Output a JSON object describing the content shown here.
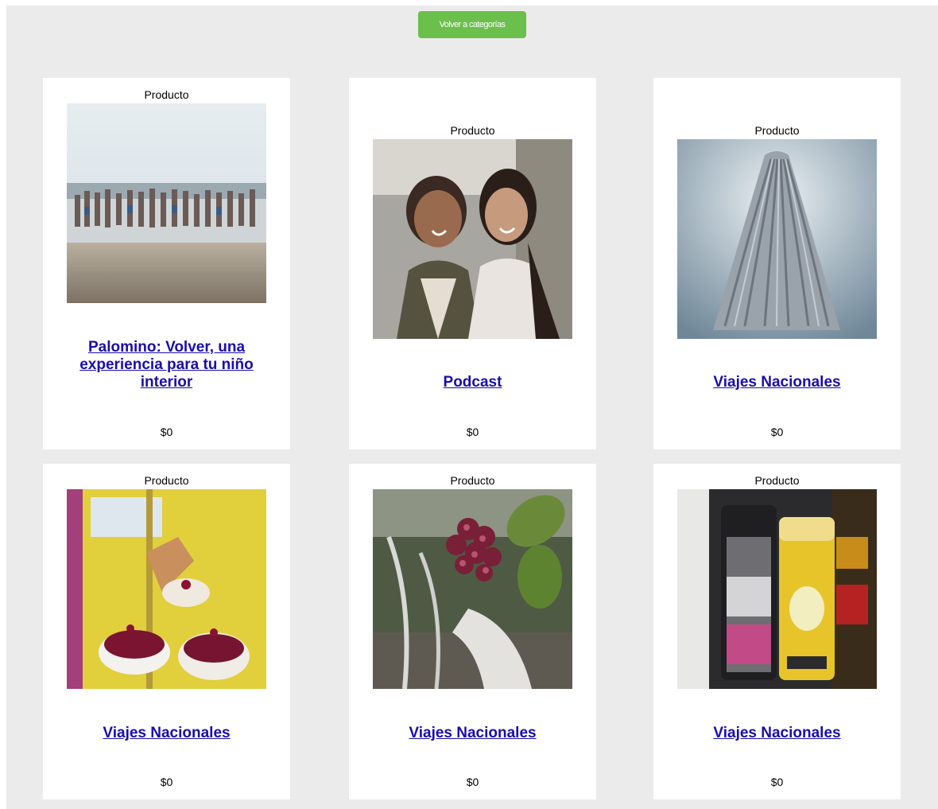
{
  "header": {
    "back_label": "Volver a categorías"
  },
  "products": [
    {
      "tag": "Producto",
      "title": "Palomino: Volver, una experiencia para tu niño interior",
      "price": "$0",
      "image": "beach-jumping-group-photo"
    },
    {
      "tag": "Producto",
      "title": "Podcast",
      "price": "$0",
      "image": "two-women-smiling-photo"
    },
    {
      "tag": "Producto",
      "title": "Viajes Nacionales",
      "price": "$0",
      "image": "mop-photo"
    },
    {
      "tag": "Producto",
      "title": "Viajes Nacionales",
      "price": "$0",
      "image": "ice-cream-sundaes-photo"
    },
    {
      "tag": "Producto",
      "title": "Viajes Nacionales",
      "price": "$0",
      "image": "flowers-bicycle-photo"
    },
    {
      "tag": "Producto",
      "title": "Viajes Nacionales",
      "price": "$0",
      "image": "shampoo-bottles-photo"
    }
  ],
  "colors": {
    "button": "#6bbf4b",
    "link": "#1a0dab",
    "background": "#ebebeb"
  }
}
